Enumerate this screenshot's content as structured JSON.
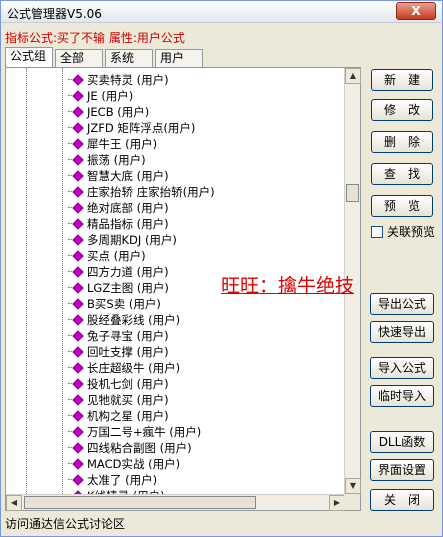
{
  "window": {
    "title": "公式管理器V5.06",
    "close_label": "X"
  },
  "info": {
    "text": "指标公式:买了不输 属性:用户公式"
  },
  "tabs": [
    {
      "label": "公式组"
    },
    {
      "label": "全部"
    },
    {
      "label": "系统"
    },
    {
      "label": "用户"
    }
  ],
  "tree": {
    "items": [
      {
        "label": "买卖特灵  (用户)"
      },
      {
        "label": "JE  (用户)"
      },
      {
        "label": "JECB  (用户)"
      },
      {
        "label": "JZFD  矩阵浮点(用户)"
      },
      {
        "label": "犀牛王  (用户)"
      },
      {
        "label": "振荡  (用户)"
      },
      {
        "label": "智慧大底  (用户)"
      },
      {
        "label": "庄家抬轿  庄家抬轿(用户)"
      },
      {
        "label": "绝对底部  (用户)"
      },
      {
        "label": "精品指标  (用户)"
      },
      {
        "label": "多周期KDJ  (用户)"
      },
      {
        "label": "买点  (用户)"
      },
      {
        "label": "四方力道  (用户)"
      },
      {
        "label": "LGZ主图  (用户)"
      },
      {
        "label": "B买S卖  (用户)"
      },
      {
        "label": "股经叠彩线  (用户)"
      },
      {
        "label": "兔子寻宝  (用户)"
      },
      {
        "label": "回吐支撑  (用户)"
      },
      {
        "label": "长庄超级牛  (用户)"
      },
      {
        "label": "投机七剑  (用户)"
      },
      {
        "label": "见牠就买  (用户)"
      },
      {
        "label": "机构之星  (用户)"
      },
      {
        "label": "万国二号+瘋牛  (用户)"
      },
      {
        "label": "四线粘合副图  (用户)"
      },
      {
        "label": "MACD实战  (用户)"
      },
      {
        "label": "太准了  (用户)"
      },
      {
        "label": "K线精灵  (用户)"
      }
    ]
  },
  "buttons": {
    "new": "新　建",
    "edit": "修　改",
    "delete": "删　除",
    "find": "查　找",
    "preview": "预　览",
    "export": "导出公式",
    "quick_export": "快速导出",
    "import": "导入公式",
    "temp_import": "临时导入",
    "dll": "DLL函数",
    "ui_settings": "界面设置",
    "close": "关　闭"
  },
  "checkbox": {
    "linked_preview": "关联预览"
  },
  "watermark": {
    "text": "旺旺：擒牛绝技"
  },
  "status": {
    "text": "访问通达信公式讨论区"
  },
  "colors": {
    "info_text": "#cc0000",
    "gem": "#c000c0",
    "watermark": "#e00000"
  }
}
